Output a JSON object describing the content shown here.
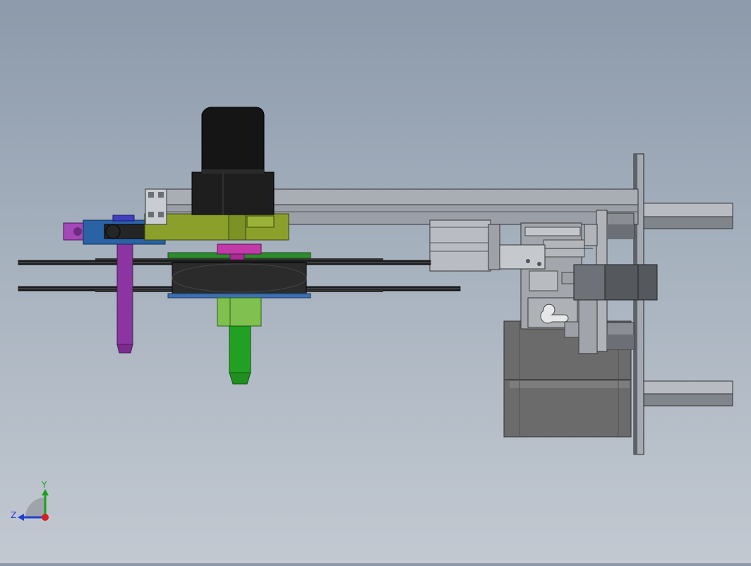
{
  "triad": {
    "y_label": "Y",
    "z_label": "Z",
    "y_color": "#1aa11a",
    "z_color": "#1f3fd6",
    "origin_color": "#d61f1f"
  }
}
